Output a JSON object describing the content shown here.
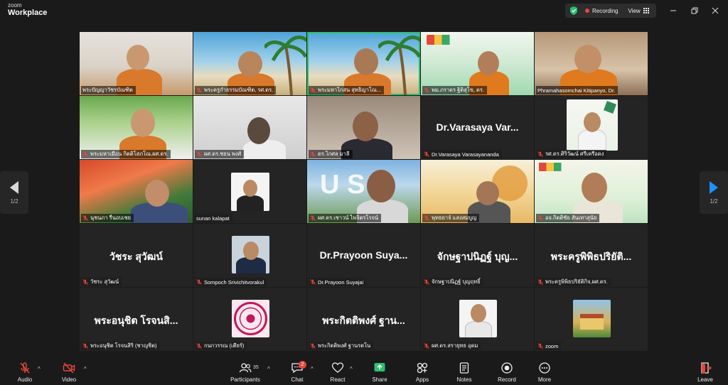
{
  "app": {
    "logo_line1": "zoom",
    "logo_line2": "Workplace"
  },
  "topbar": {
    "recording_label": "Recording",
    "view_label": "View"
  },
  "tiles": [
    {
      "name": "พระปัญญาวัชรบัณฑิต",
      "muted": false
    },
    {
      "name": "พระครูกำธรรมบัณฑิต, รศ.ดร.",
      "muted": true
    },
    {
      "name": "พระมหาไกสน สุทธิญาโณ...",
      "muted": true
    },
    {
      "name": "พม.ภราดร ฐิติสุโข, ดร.",
      "muted": true
    },
    {
      "name": "Phramahasomchai Kitipanyo, Dr.",
      "muted": false
    },
    {
      "name": "พระมหาเมือน กิตติโสภโณ,ผศ.ดร.",
      "muted": true
    },
    {
      "name": "ผศ.ดร.ชยน พงศ์",
      "muted": true
    },
    {
      "name": "ดร.ไกศล มาลี",
      "muted": true
    },
    {
      "name": "Dr.Varasaya Varasayananda",
      "muted": true,
      "display": "Dr.Varasaya Var..."
    },
    {
      "name": "รศ.ดร.ศิริวัฒน์ ศรีเครือดง",
      "muted": true
    },
    {
      "name": "นุชนภา รื่นอบเชย",
      "muted": true
    },
    {
      "name": "sunan kalapat",
      "muted": false
    },
    {
      "name": "ผศ.ดร.เชาวน์ ไพจิตรโรจน์",
      "muted": true
    },
    {
      "name": "พุทธยาจ์ แสงสมบูญ",
      "muted": true
    },
    {
      "name": "อจ.กิตติชัย สันเทาสุนัย",
      "muted": true
    },
    {
      "name": "วัชระ สุวัฒน์",
      "muted": true,
      "display": "วัชระ สุวัฒน์"
    },
    {
      "name": "Sompoch Srivichitvorakul",
      "muted": true
    },
    {
      "name": "Dr.Prayoon Suyajai",
      "muted": true,
      "display": "Dr.Prayoon Suya..."
    },
    {
      "name": "จักษฐาปนิฏฐ์ บุญฤทธิ์",
      "muted": true,
      "display": "จักษฐาปนิฏฐ์ บุญ..."
    },
    {
      "name": "พระครูพิพิธปริยัติกิจ,ผศ.ดร.",
      "muted": true,
      "display": "พระครูพิพิธปริยัติ..."
    },
    {
      "name": "พระอนุชิต โรจนสิริ (ชาญชิต)",
      "muted": true,
      "display": "พระอนุชิต โรจนสิ..."
    },
    {
      "name": "กนกวรรณ (เตียร์)",
      "muted": true
    },
    {
      "name": "พระกิตติพงศ์ ฐานรตโน",
      "muted": true,
      "display": "พระกิตติพงศ์ ฐาน..."
    },
    {
      "name": "ผศ.ดร.สรายุทธ อุดม",
      "muted": true
    },
    {
      "name": "zoom",
      "muted": true
    }
  ],
  "pagination": {
    "left": "1/2",
    "right": "1/2"
  },
  "toolbar": {
    "audio": "Audio",
    "video": "Video",
    "participants": "Participants",
    "participants_count": "35",
    "chat": "Chat",
    "chat_badge": "2",
    "react": "React",
    "share": "Share",
    "apps": "Apps",
    "notes": "Notes",
    "record": "Record",
    "more": "More",
    "leave": "Leave"
  },
  "colors": {
    "active_speaker": "#2dbf6f",
    "share": "#2dbf6f",
    "muted": "#e8453c",
    "page_next": "#1e90ff"
  }
}
